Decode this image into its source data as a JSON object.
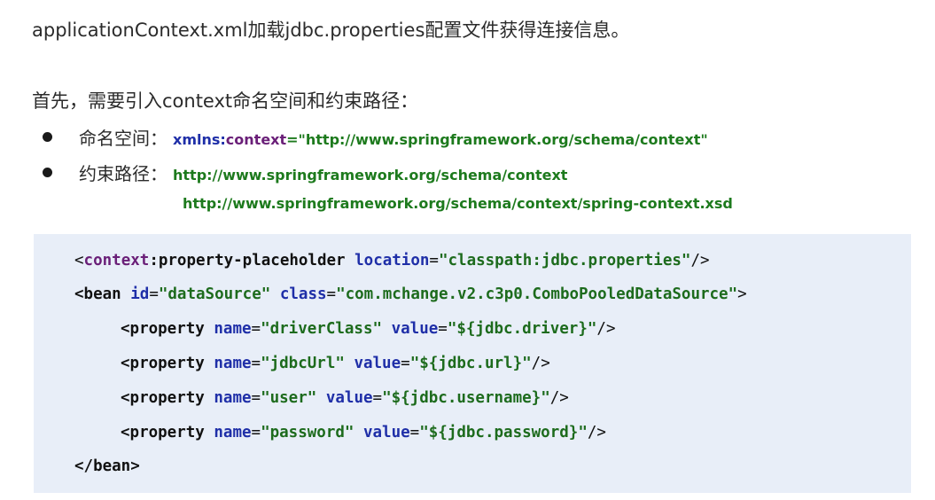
{
  "headline": "applicationContext.xml加载jdbc.properties配置文件获得连接信息。",
  "intro": "首先，需要引入context命名空间和约束路径：",
  "bullets": {
    "namespace": {
      "label": "命名空间：",
      "xmlns": "xmlns",
      "colon": ":",
      "context": "context",
      "value": "=\"http://www.springframework.org/schema/context\""
    },
    "constraint": {
      "label": "约束路径：",
      "url1": "http://www.springframework.org/schema/context",
      "url2": "http://www.springframework.org/schema/context/spring-context.xsd"
    }
  },
  "code": {
    "line1": {
      "open": "<",
      "ns": "context",
      "rest": ":property-placeholder",
      "attr": "location",
      "eq": "=",
      "val": "\"classpath:jdbc.properties\"",
      "close": "/>"
    },
    "line2": {
      "open": "<bean",
      "attr1": "id",
      "eq1": "=",
      "val1": "\"dataSource\"",
      "attr2": "class",
      "eq2": "=",
      "val2": "\"com.mchange.v2.c3p0.ComboPooledDataSource\"",
      "close": ">"
    },
    "properties": [
      {
        "open": "<property",
        "name_attr": "name",
        "eq1": "=",
        "name_val": "\"driverClass\"",
        "value_attr": "value",
        "eq2": "=",
        "value_val": "\"${jdbc.driver}\"",
        "close": "/>"
      },
      {
        "open": "<property",
        "name_attr": "name",
        "eq1": "=",
        "name_val": "\"jdbcUrl\"",
        "value_attr": "value",
        "eq2": "=",
        "value_val": "\"${jdbc.url}\"",
        "close": "/>"
      },
      {
        "open": "<property",
        "name_attr": "name",
        "eq1": "=",
        "name_val": "\"user\"",
        "value_attr": "value",
        "eq2": "=",
        "value_val": "\"${jdbc.username}\"",
        "close": "/>"
      },
      {
        "open": "<property",
        "name_attr": "name",
        "eq1": "=",
        "name_val": "\"password\"",
        "value_attr": "value",
        "eq2": "=",
        "value_val": "\"${jdbc.password}\"",
        "close": "/>"
      }
    ],
    "end": "</bean>"
  },
  "colors": {
    "code_background": "#e8eef8",
    "attribute": "#1f2fa8",
    "namespace": "#6a1f78",
    "string": "#1d6b1d"
  }
}
